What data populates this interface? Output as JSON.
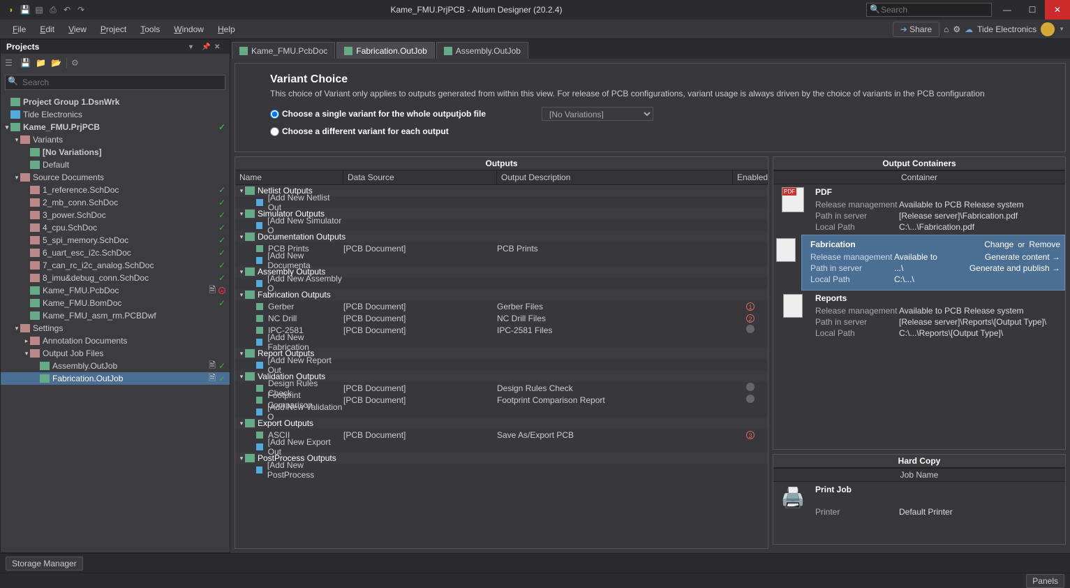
{
  "title": "Kame_FMU.PrjPCB - Altium Designer (20.2.4)",
  "search_placeholder": "Search",
  "menu": [
    "File",
    "Edit",
    "View",
    "Project",
    "Tools",
    "Window",
    "Help"
  ],
  "share_label": "Share",
  "tide_label": "Tide Electronics",
  "projects_panel_title": "Projects",
  "proj_search_placeholder": "Search",
  "tree": {
    "root": "Project Group 1.DsnWrk",
    "tide": "Tide Electronics",
    "project": "Kame_FMU.PrjPCB",
    "variants_label": "Variants",
    "no_variations": "[No Variations]",
    "default_variant": "Default",
    "source_docs": "Source Documents",
    "source_files": [
      "1_reference.SchDoc",
      "2_mb_conn.SchDoc",
      "3_power.SchDoc",
      "4_cpu.SchDoc",
      "5_spi_memory.SchDoc",
      "6_uart_esc_i2c.SchDoc",
      "7_can_rc_i2c_analog.SchDoc",
      "8_imu&debug_conn.SchDoc"
    ],
    "pcbdoc": "Kame_FMU.PcbDoc",
    "bomdoc": "Kame_FMU.BomDoc",
    "asm": "Kame_FMU_asm_rm.PCBDwf",
    "settings": "Settings",
    "annot": "Annotation Documents",
    "outjob_folder": "Output Job Files",
    "outjob1": "Assembly.OutJob",
    "outjob2": "Fabrication.OutJob"
  },
  "tabs": [
    "Kame_FMU.PcbDoc",
    "Fabrication.OutJob",
    "Assembly.OutJob"
  ],
  "variant": {
    "heading": "Variant Choice",
    "desc": "This choice of Variant only applies to outputs generated from within this view. For release of PCB configurations, variant usage is always driven by the choice of variants in the PCB configuration",
    "opt1": "Choose a single variant for the whole outputjob file",
    "opt2": "Choose a different variant for each output",
    "selected": "[No Variations]"
  },
  "outputs_header": "Outputs",
  "outputs_cols": {
    "name": "Name",
    "ds": "Data Source",
    "desc": "Output Description",
    "en": "Enabled"
  },
  "outputs": [
    {
      "cat": "Netlist Outputs",
      "rows": [
        {
          "name": "[Add New Netlist Out",
          "ds": "",
          "desc": "",
          "add": true
        }
      ]
    },
    {
      "cat": "Simulator Outputs",
      "rows": [
        {
          "name": "[Add New Simulator O",
          "ds": "",
          "desc": "",
          "add": true
        }
      ]
    },
    {
      "cat": "Documentation Outputs",
      "rows": [
        {
          "name": "PCB Prints",
          "ds": "[PCB Document]",
          "desc": "PCB Prints"
        },
        {
          "name": "[Add New Documenta",
          "ds": "",
          "desc": "",
          "add": true
        }
      ]
    },
    {
      "cat": "Assembly Outputs",
      "rows": [
        {
          "name": "[Add New Assembly O",
          "ds": "",
          "desc": "",
          "add": true
        }
      ]
    },
    {
      "cat": "Fabrication Outputs",
      "rows": [
        {
          "name": "Gerber",
          "ds": "[PCB Document]",
          "desc": "Gerber Files",
          "en": "1"
        },
        {
          "name": "NC Drill",
          "ds": "[PCB Document]",
          "desc": "NC Drill Files",
          "en": "2"
        },
        {
          "name": "IPC-2581",
          "ds": "[PCB Document]",
          "desc": "IPC-2581 Files",
          "en": ""
        },
        {
          "name": "[Add New Fabrication",
          "ds": "",
          "desc": "",
          "add": true
        }
      ]
    },
    {
      "cat": "Report Outputs",
      "rows": [
        {
          "name": "[Add New Report Out",
          "ds": "",
          "desc": "",
          "add": true
        }
      ]
    },
    {
      "cat": "Validation Outputs",
      "rows": [
        {
          "name": "Design Rules Check",
          "ds": "[PCB Document]",
          "desc": "Design Rules Check",
          "en": ""
        },
        {
          "name": "Footprint Comparison",
          "ds": "[PCB Document]",
          "desc": "Footprint Comparison Report",
          "en": ""
        },
        {
          "name": "[Add New Validation O",
          "ds": "",
          "desc": "",
          "add": true
        }
      ]
    },
    {
      "cat": "Export Outputs",
      "rows": [
        {
          "name": "ASCII",
          "ds": "[PCB Document]",
          "desc": "Save As/Export PCB",
          "en": "3"
        },
        {
          "name": "[Add New Export Out",
          "ds": "",
          "desc": "",
          "add": true
        }
      ]
    },
    {
      "cat": "PostProcess Outputs",
      "rows": [
        {
          "name": "[Add New PostProcess",
          "ds": "",
          "desc": "",
          "add": true
        }
      ]
    }
  ],
  "containers_header": "Output Containers",
  "containers_col": "Container",
  "containers": [
    {
      "name": "PDF",
      "kv": [
        [
          "Release management",
          "Available to PCB Release system"
        ],
        [
          "Path in server",
          "[Release server]\\Fabrication.pdf"
        ],
        [
          "Local Path",
          "C:\\...\\Fabrication.pdf"
        ]
      ]
    },
    {
      "name": "Fabrication",
      "active": true,
      "topright": [
        "Change",
        "or",
        "Remove"
      ],
      "kv": [
        [
          "Release management",
          "Available to"
        ],
        [
          "Path in server",
          "...\\"
        ],
        [
          "Local Path",
          "C:\\...\\"
        ]
      ],
      "actions": [
        "Generate content →",
        "Generate and publish →"
      ]
    },
    {
      "name": "Reports",
      "kv": [
        [
          "Release management",
          "Available to PCB Release system"
        ],
        [
          "Path in server",
          "[Release server]\\Reports\\[Output Type]\\"
        ],
        [
          "Local Path",
          "C:\\...\\Reports\\[Output Type]\\"
        ]
      ]
    }
  ],
  "hardcopy_header": "Hard Copy",
  "hardcopy_col": "Job Name",
  "print_job": "Print Job",
  "printer_label": "Printer",
  "printer_value": "Default Printer",
  "storage_mgr": "Storage Manager",
  "panels_btn": "Panels"
}
